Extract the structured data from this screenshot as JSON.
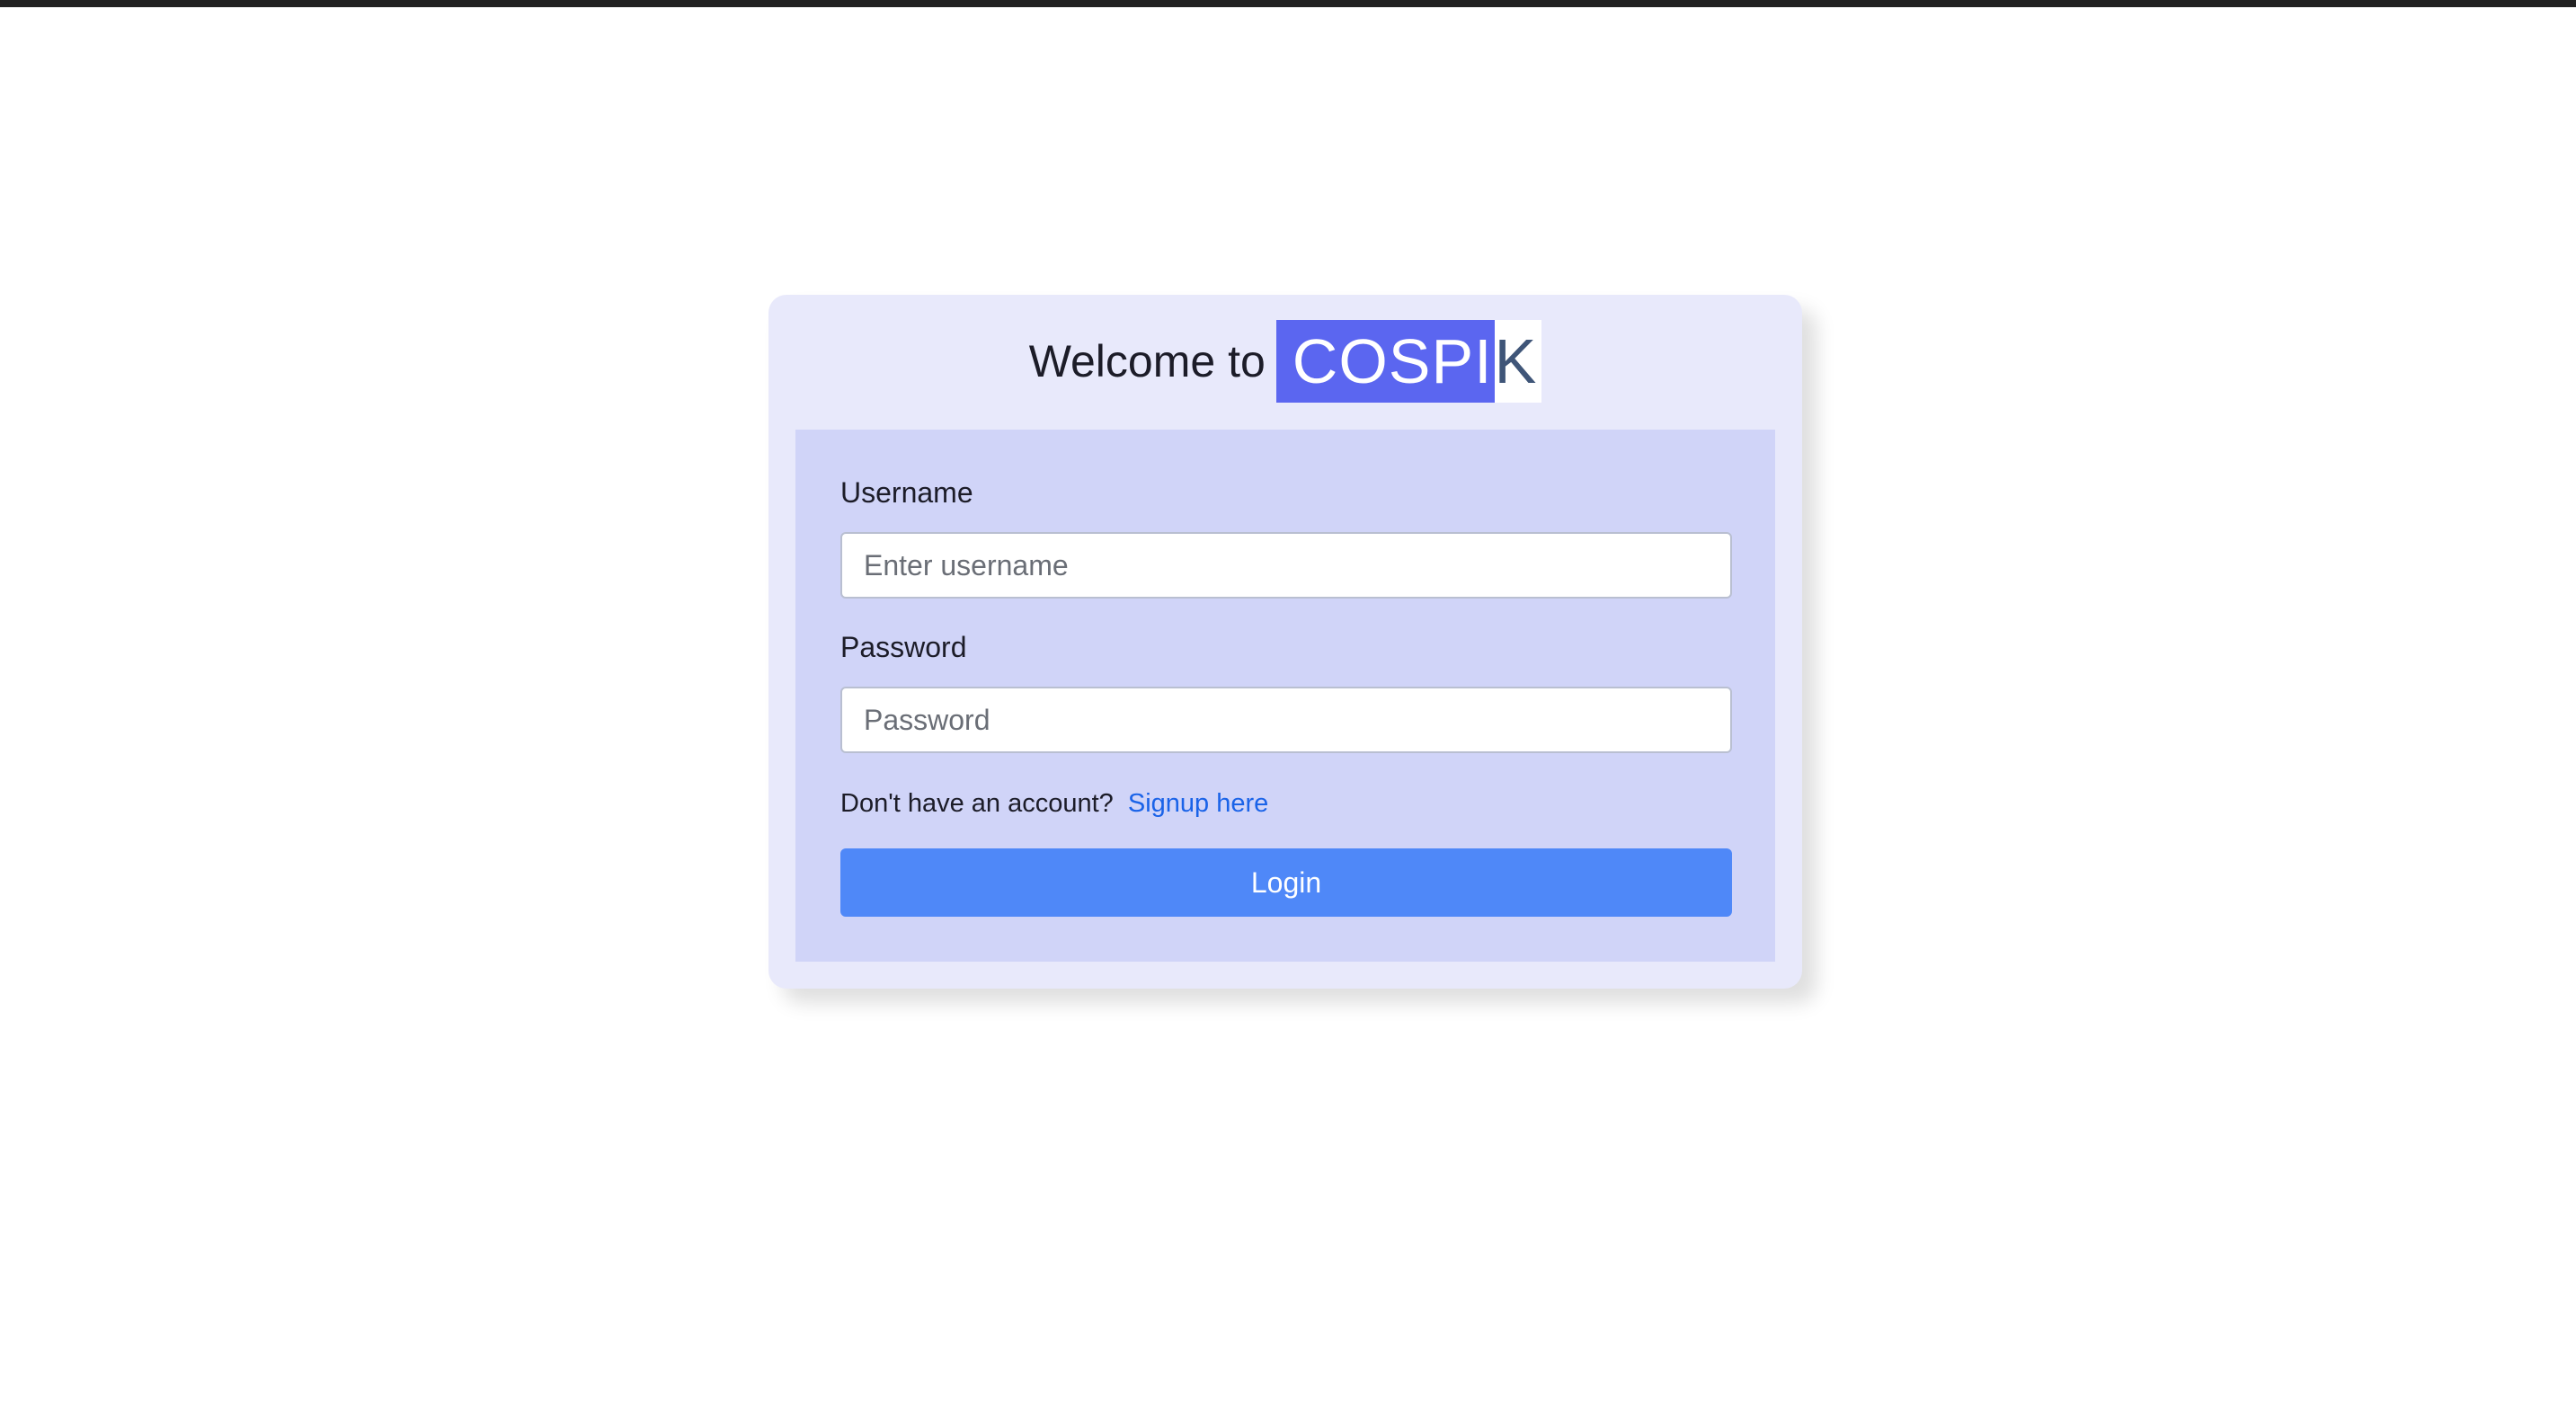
{
  "header": {
    "welcome_text": "Welcome to",
    "logo_main": "COSPI",
    "logo_tail": "K"
  },
  "form": {
    "username_label": "Username",
    "username_placeholder": "Enter username",
    "username_value": "",
    "password_label": "Password",
    "password_placeholder": "Password",
    "password_value": "",
    "signup_prompt": "Don't have an account?",
    "signup_link": "Signup here",
    "login_button": "Login"
  },
  "colors": {
    "brand": "#5b66f0",
    "card_background": "#e8e9fb",
    "panel_background": "#d0d4f8",
    "link": "#1a63e8",
    "button": "#4f88f8"
  }
}
